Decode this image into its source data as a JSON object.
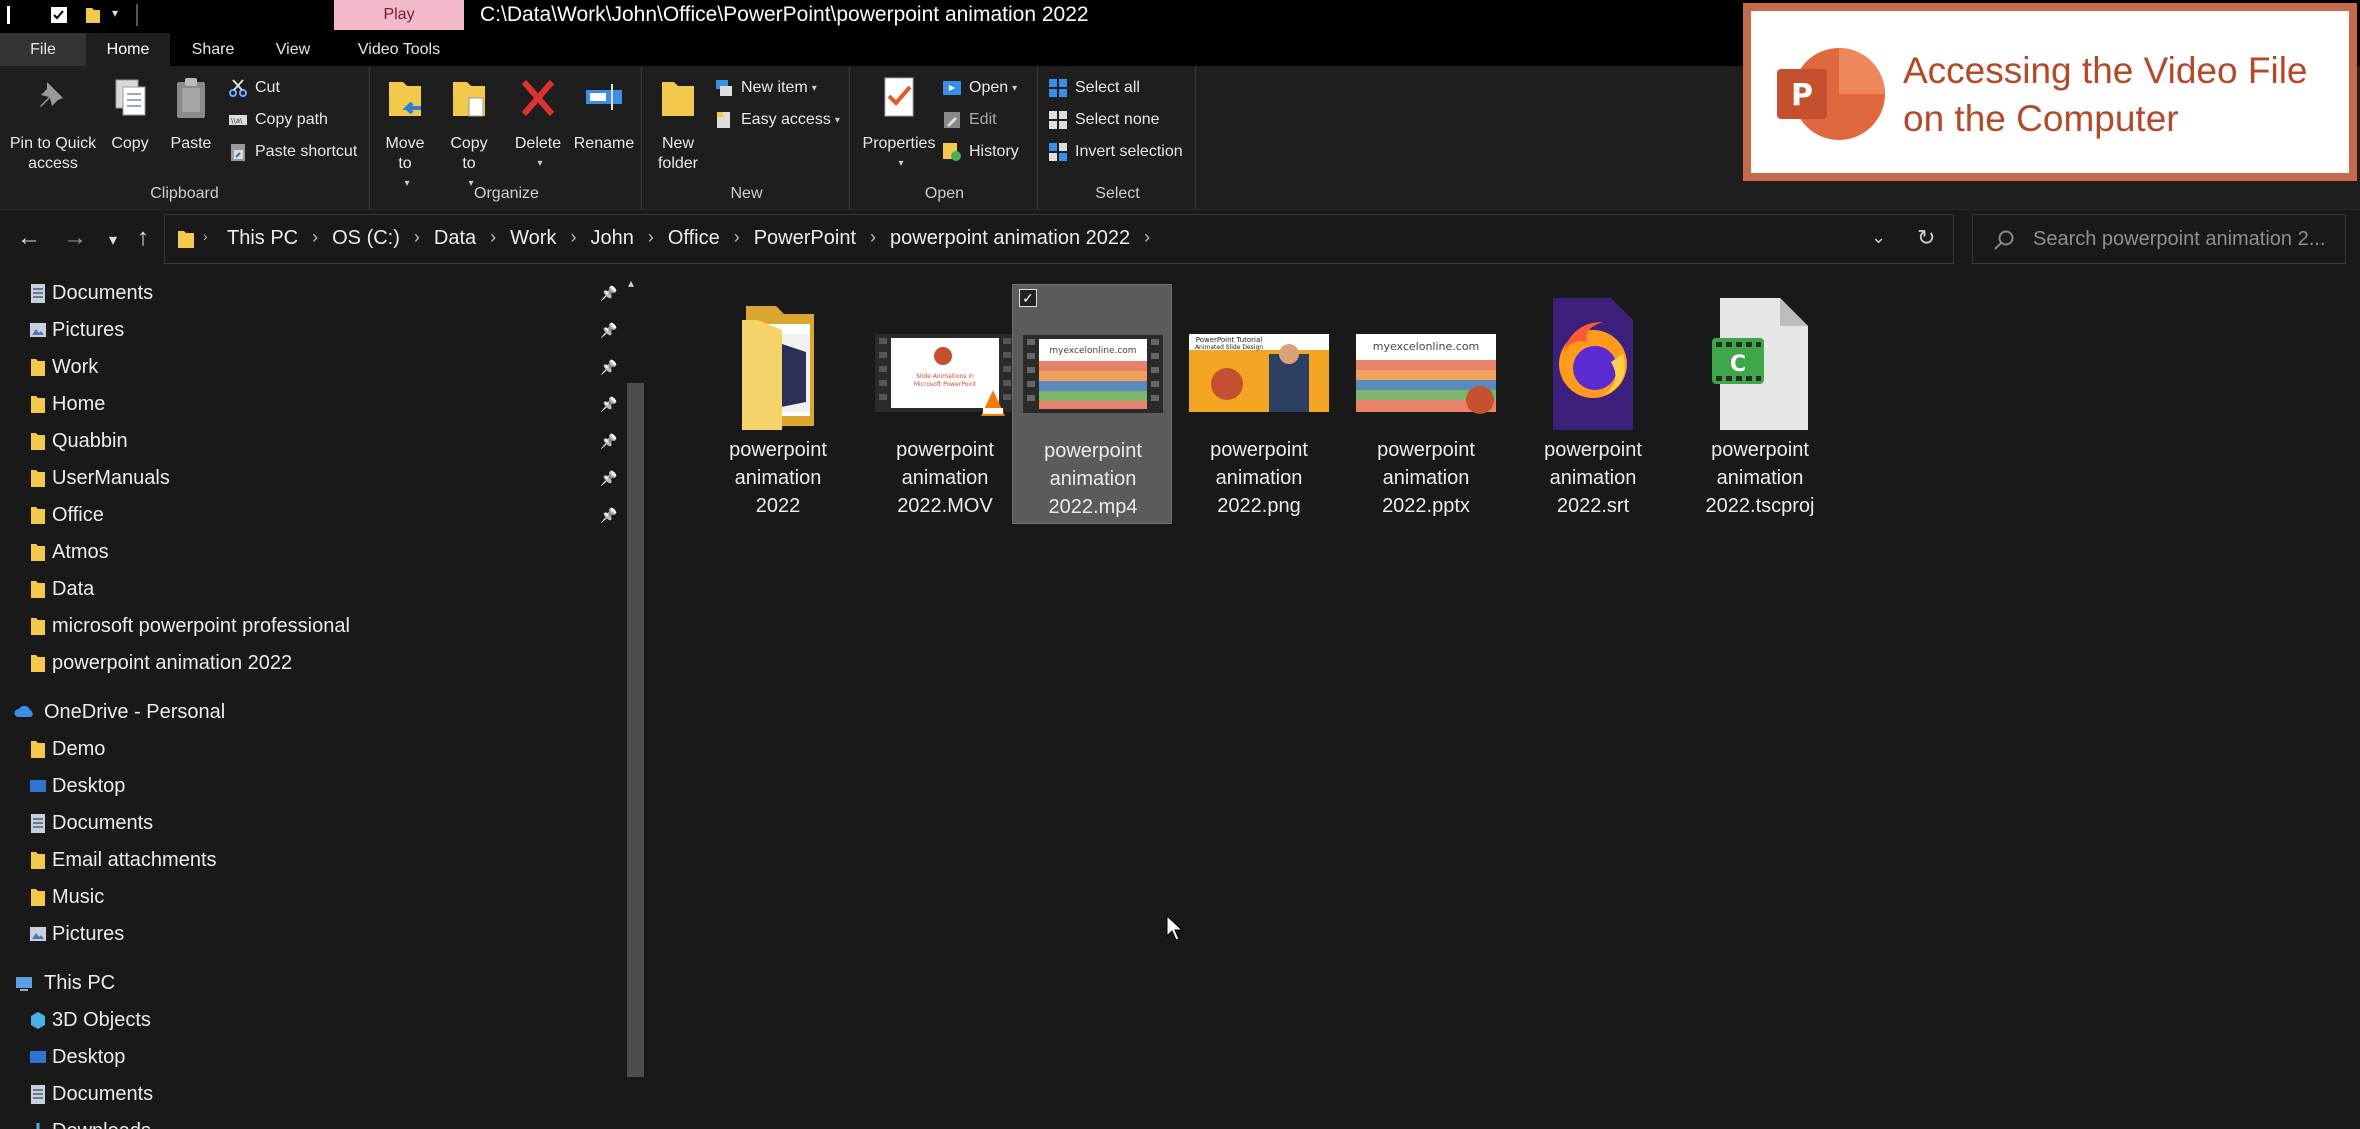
{
  "titlebar": {
    "play_tab": "Play",
    "path": "C:\\Data\\Work\\John\\Office\\PowerPoint\\powerpoint animation 2022"
  },
  "tabs": [
    "File",
    "Home",
    "Share",
    "View",
    "Video Tools"
  ],
  "ribbon": {
    "clipboard": {
      "pin": "Pin to Quick access",
      "copy": "Copy",
      "paste": "Paste",
      "cut": "Cut",
      "copy_path": "Copy path",
      "paste_shortcut": "Paste shortcut",
      "label": "Clipboard"
    },
    "organize": {
      "move_to": "Move to",
      "copy_to": "Copy to",
      "delete": "Delete",
      "rename": "Rename",
      "label": "Organize"
    },
    "new": {
      "new_folder": "New folder",
      "new_item": "New item",
      "easy_access": "Easy access",
      "label": "New"
    },
    "open": {
      "properties": "Properties",
      "open": "Open",
      "edit": "Edit",
      "history": "History",
      "label": "Open"
    },
    "select": {
      "select_all": "Select all",
      "select_none": "Select none",
      "invert": "Invert selection",
      "label": "Select"
    }
  },
  "address": {
    "crumbs": [
      "This PC",
      "OS (C:)",
      "Data",
      "Work",
      "John",
      "Office",
      "PowerPoint",
      "powerpoint animation 2022"
    ],
    "search_placeholder": "Search powerpoint animation 2..."
  },
  "sidebar": {
    "quick_access": [
      {
        "label": "Documents",
        "icon": "documents-icon",
        "pinned": true
      },
      {
        "label": "Pictures",
        "icon": "pictures-icon",
        "pinned": true
      },
      {
        "label": "Work",
        "icon": "folder-icon",
        "pinned": true
      },
      {
        "label": "Home",
        "icon": "folder-icon",
        "pinned": true
      },
      {
        "label": "Quabbin",
        "icon": "folder-icon",
        "pinned": true
      },
      {
        "label": "UserManuals",
        "icon": "folder-icon",
        "pinned": true
      },
      {
        "label": "Office",
        "icon": "folder-icon",
        "pinned": true
      },
      {
        "label": "Atmos",
        "icon": "folder-icon",
        "pinned": false
      },
      {
        "label": "Data",
        "icon": "folder-icon",
        "pinned": false
      },
      {
        "label": "microsoft powerpoint professional",
        "icon": "folder-icon",
        "pinned": false
      },
      {
        "label": "powerpoint animation 2022",
        "icon": "folder-icon",
        "pinned": false
      }
    ],
    "onedrive": "OneDrive - Personal",
    "onedrive_items": [
      {
        "label": "Demo",
        "icon": "folder-icon"
      },
      {
        "label": "Desktop",
        "icon": "desktop-icon"
      },
      {
        "label": "Documents",
        "icon": "documents-icon"
      },
      {
        "label": "Email attachments",
        "icon": "folder-icon"
      },
      {
        "label": "Music",
        "icon": "folder-icon"
      },
      {
        "label": "Pictures",
        "icon": "pictures-icon"
      }
    ],
    "this_pc": "This PC",
    "this_pc_items": [
      {
        "label": "3D Objects",
        "icon": "3d-objects-icon"
      },
      {
        "label": "Desktop",
        "icon": "desktop-icon"
      },
      {
        "label": "Documents",
        "icon": "documents-icon"
      },
      {
        "label": "Downloads",
        "icon": "downloads-icon"
      }
    ]
  },
  "files": [
    {
      "name_lines": [
        "powerpoint",
        "animation",
        "2022"
      ],
      "type": "folder",
      "selected": false
    },
    {
      "name_lines": [
        "powerpoint",
        "animation",
        "2022.MOV"
      ],
      "type": "mov",
      "selected": false
    },
    {
      "name_lines": [
        "powerpoint",
        "animation",
        "2022.mp4"
      ],
      "type": "mp4",
      "selected": true
    },
    {
      "name_lines": [
        "powerpoint",
        "animation",
        "2022.png"
      ],
      "type": "png",
      "selected": false
    },
    {
      "name_lines": [
        "powerpoint",
        "animation",
        "2022.pptx"
      ],
      "type": "pptx",
      "selected": false
    },
    {
      "name_lines": [
        "powerpoint",
        "animation",
        "2022.srt"
      ],
      "type": "srt",
      "selected": false
    },
    {
      "name_lines": [
        "powerpoint",
        "animation",
        "2022.tscproj"
      ],
      "type": "tscproj",
      "selected": false
    }
  ],
  "thumb_text": {
    "mov_title_1": "Slide Animations in",
    "mov_title_2": "Microsoft PowerPoint",
    "brand": "myexcelonline.com",
    "png_title_1": "PowerPoint Tutorial",
    "png_title_2": "Animated Slide Design",
    "tscproj_letter": "C"
  },
  "overlay": {
    "line1": "Accessing the Video File",
    "line2": "on the Computer",
    "logo_letter": "P"
  },
  "colors": {
    "folder": "#f2c94c",
    "accent_blue": "#4f8fd8",
    "delete_red": "#e03030",
    "ppt_orange": "#c5502f"
  }
}
